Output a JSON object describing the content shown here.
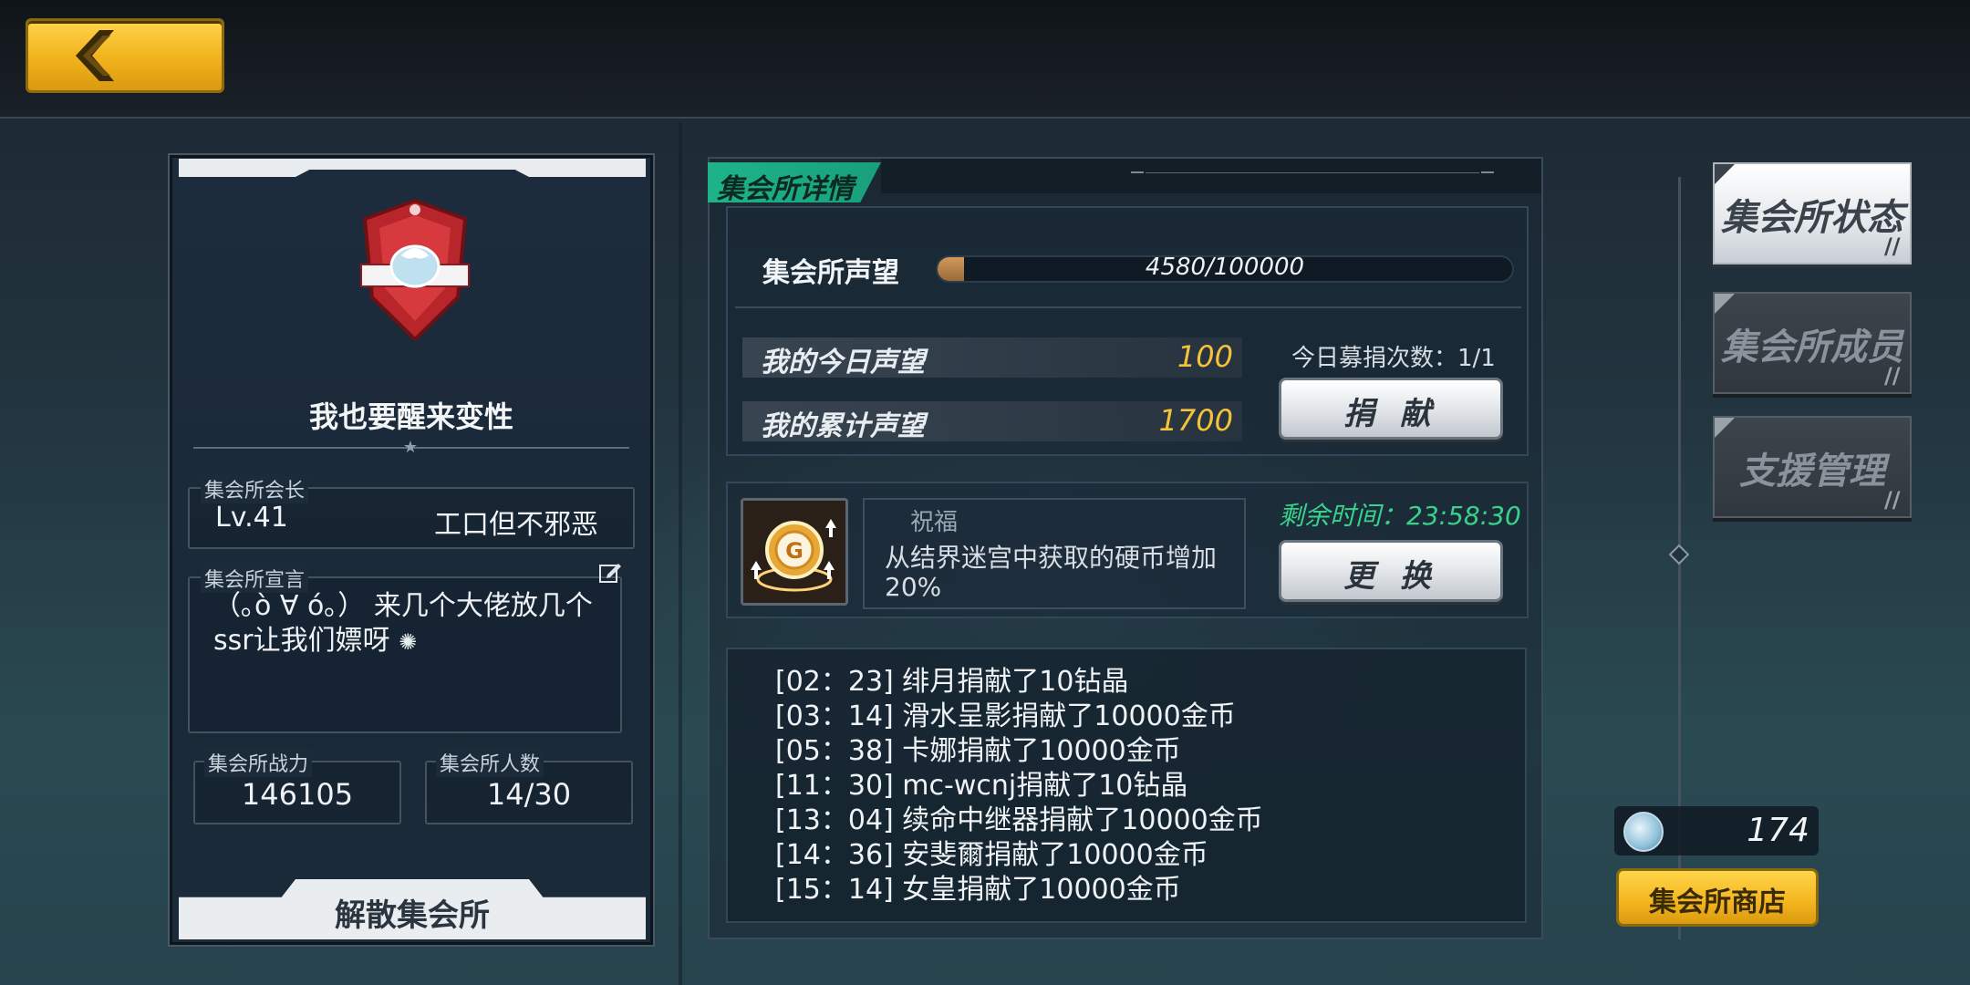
{
  "top": {
    "back_icon": "chevron-left-icon",
    "accent_color": "#f0b21c"
  },
  "guild_card": {
    "crest_icon": "guild-crest-icon",
    "name": "我也要醒来变性",
    "leader": {
      "label": "集会所会长",
      "level": "Lv.41",
      "name": "工口但不邪恶"
    },
    "declaration": {
      "label": "集会所宣言",
      "text": "（｡ò ∀ ó｡） 来几个大佬放几个ssr让我们嫖呀",
      "emoji": "✺",
      "edit_icon": "edit-icon"
    },
    "power": {
      "label": "集会所战力",
      "value": "146105"
    },
    "members": {
      "label": "集会所人数",
      "value": "14/30"
    },
    "disband_label": "解散集会所"
  },
  "details": {
    "tab_title": "集会所详情",
    "reputation": {
      "label": "集会所声望",
      "value_text": "4580/100000",
      "progress": 0.0458
    },
    "my_today": {
      "label": "我的今日声望",
      "value": "100"
    },
    "my_total": {
      "label": "我的累计声望",
      "value": "1700"
    },
    "donate_count": "今日募捐次数：1/1",
    "donate_label": "捐 献",
    "blessing": {
      "icon": "coin-bonus-icon",
      "title": "祝福",
      "desc": "从结界迷宫中获取的硬币增加20%",
      "remain": "剩余时间：23:58:30",
      "change_label": "更 换"
    },
    "log": [
      "[02：23] 绯月捐献了10钻晶",
      "[03：14] 滑水呈影捐献了10000金币",
      "[05：38] 卡娜捐献了10000金币",
      "[11：30] mc-wcnj捐献了10钻晶",
      "[13：04] 续命中继器捐献了10000金币",
      "[14：36] 安斐爾捐献了10000金币",
      "[15：14] 女皇捐献了10000金币"
    ]
  },
  "side_menu": {
    "items": [
      {
        "label": "集会所状态",
        "active": true
      },
      {
        "label": "集会所成员",
        "active": false
      },
      {
        "label": "支援管理",
        "active": false
      }
    ],
    "slash": "//"
  },
  "currency": {
    "icon": "guild-coin-icon",
    "value": "174",
    "shop_label": "集会所商店"
  }
}
